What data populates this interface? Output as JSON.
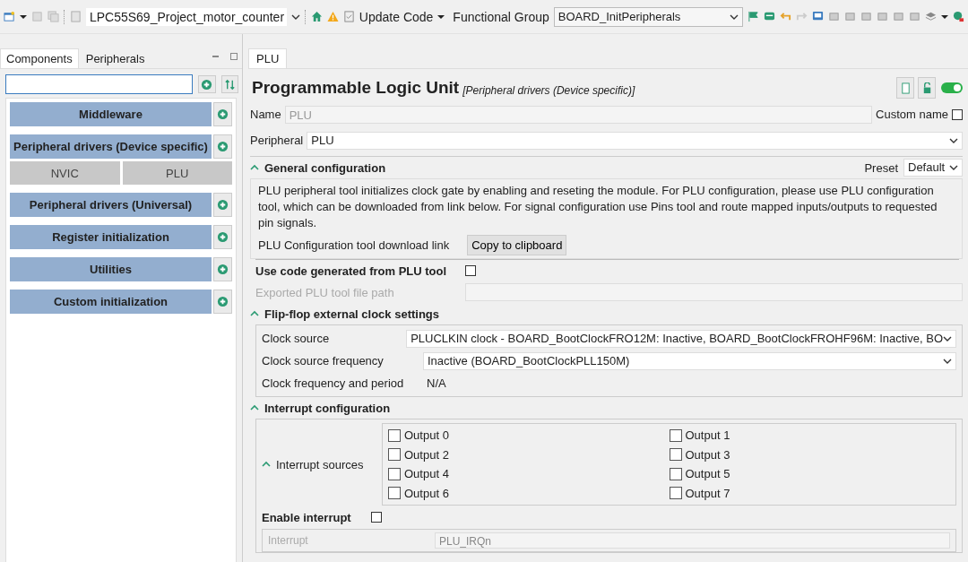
{
  "toolbar": {
    "project": "LPC55S69_Project_motor_counter",
    "update_code": "Update Code",
    "functional_group_label": "Functional Group",
    "functional_group": "BOARD_InitPeripherals"
  },
  "left_panel": {
    "tabs": [
      {
        "label": "Components",
        "selected": true
      },
      {
        "label": "Peripherals",
        "selected": false
      }
    ],
    "categories": [
      {
        "label": "Middleware"
      },
      {
        "label": "Peripheral drivers (Device specific)",
        "children": [
          "NVIC",
          "PLU"
        ]
      },
      {
        "label": "Peripheral drivers (Universal)"
      },
      {
        "label": "Register initialization"
      },
      {
        "label": "Utilities"
      },
      {
        "label": "Custom initialization"
      }
    ]
  },
  "editor": {
    "tab": "PLU",
    "title": "Programmable Logic Unit",
    "subtitle": "[Peripheral drivers (Device specific)]",
    "enabled": true,
    "name_label": "Name",
    "name_value": "PLU",
    "custom_name_label": "Custom name",
    "custom_name": false,
    "peripheral_label": "Peripheral",
    "peripheral": "PLU",
    "general": {
      "title": "General configuration",
      "expanded": true,
      "preset_label": "Preset",
      "preset": "Default",
      "description": "PLU peripheral tool initializes clock gate by enabling and reseting the module. For PLU configuration, please use PLU configuration tool, which can be downloaded from link below. For signal configuration use Pins tool and route mapped inputs/outputs to requested pin signals.",
      "link_label": "PLU Configuration tool download link",
      "copy_button": "Copy to clipboard"
    },
    "use_code_label": "Use code generated from PLU tool",
    "use_code": false,
    "exported_path_label": "Exported PLU tool file path",
    "flipflop": {
      "title": "Flip-flop external clock settings",
      "expanded": true,
      "rows": [
        {
          "kind": "select",
          "label": "Clock source",
          "value": "PLUCLKIN clock - BOARD_BootClockFRO12M: Inactive, BOARD_BootClockFROHF96M: Inactive, BO"
        },
        {
          "kind": "select",
          "label": "Clock source frequency",
          "value": "Inactive (BOARD_BootClockPLL150M)"
        },
        {
          "kind": "text",
          "label": "Clock frequency and period",
          "value": "N/A"
        }
      ]
    },
    "interrupt": {
      "title": "Interrupt configuration",
      "expanded": true,
      "sources_label": "Interrupt sources",
      "sources_expanded": true,
      "outputs": [
        {
          "label": "Output 0",
          "checked": false
        },
        {
          "label": "Output 1",
          "checked": false
        },
        {
          "label": "Output 2",
          "checked": false
        },
        {
          "label": "Output 3",
          "checked": false
        },
        {
          "label": "Output 4",
          "checked": false
        },
        {
          "label": "Output 5",
          "checked": false
        },
        {
          "label": "Output 6",
          "checked": false
        },
        {
          "label": "Output 7",
          "checked": false
        }
      ],
      "enable_label": "Enable interrupt",
      "enable": false,
      "irq_label": "Interrupt",
      "irq_value": "PLU_IRQn"
    }
  }
}
